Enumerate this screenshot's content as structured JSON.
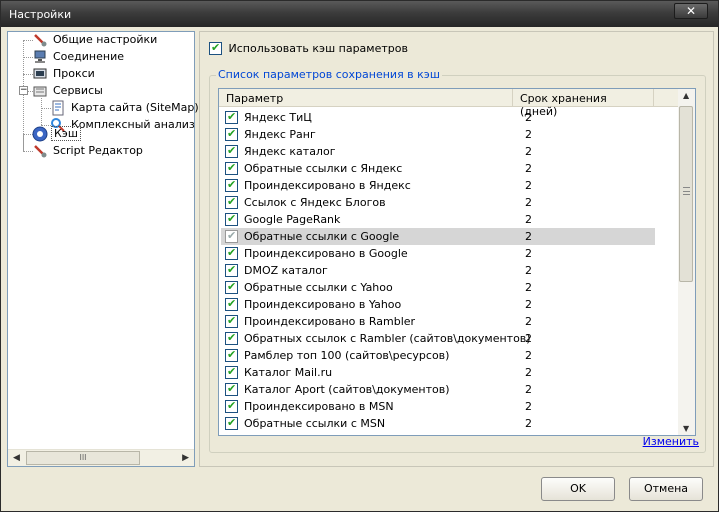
{
  "window": {
    "title": "Настройки",
    "close_label": "✕"
  },
  "tree": {
    "items": [
      {
        "label": "Общие настройки",
        "icon": "wrench-icon"
      },
      {
        "label": "Соединение",
        "icon": "network-icon"
      },
      {
        "label": "Прокси",
        "icon": "proxy-icon"
      },
      {
        "label": "Сервисы",
        "icon": "services-icon",
        "expander": "−"
      },
      {
        "label": "Карта сайта (SiteMap)",
        "icon": "sitemap-icon"
      },
      {
        "label": "Комплексный анализ по",
        "icon": "analysis-icon"
      },
      {
        "label": "Кэш",
        "icon": "cache-icon",
        "selected": true
      },
      {
        "label": "Script Редактор",
        "icon": "wrench-icon"
      }
    ],
    "scroll_grip": "III"
  },
  "settings": {
    "use_cache_label": "Использовать кэш параметров",
    "use_cache_checked": true,
    "group_label": "Список параметров сохранения в кэш",
    "columns": {
      "param": "Параметр",
      "days": "Срок хранения (дней)"
    },
    "rows": [
      {
        "name": "Яндекс ТиЦ",
        "days": "2"
      },
      {
        "name": "Яндекс Ранг",
        "days": "2"
      },
      {
        "name": "Яндекс каталог",
        "days": "2"
      },
      {
        "name": "Обратные ссылки с Яндекс",
        "days": "2"
      },
      {
        "name": "Проиндексировано в Яндекс",
        "days": "2"
      },
      {
        "name": "Ссылок с Яндекс Блогов",
        "days": "2"
      },
      {
        "name": "Google PageRank",
        "days": "2"
      },
      {
        "name": "Обратные ссылки с Google",
        "days": "2",
        "highlighted": true
      },
      {
        "name": "Проиндексировано в Google",
        "days": "2"
      },
      {
        "name": "DMOZ каталог",
        "days": "2"
      },
      {
        "name": "Обратные ссылки с Yahoo",
        "days": "2"
      },
      {
        "name": "Проиндексировано в Yahoo",
        "days": "2"
      },
      {
        "name": "Проиндексировано в Rambler",
        "days": "2"
      },
      {
        "name": "Обратных ссылок с Rambler (сайтов\\документов)",
        "days": "2"
      },
      {
        "name": "Рамблер топ 100 (сайтов\\ресурсов)",
        "days": "2"
      },
      {
        "name": "Каталог Mail.ru",
        "days": "2"
      },
      {
        "name": "Каталог Aport (сайтов\\документов)",
        "days": "2"
      },
      {
        "name": "Проиндексировано в MSN",
        "days": "2"
      },
      {
        "name": "Обратные ссылки с MSN",
        "days": "2"
      }
    ],
    "change_link": "Изменить"
  },
  "buttons": {
    "ok": "OK",
    "cancel": "Отмена"
  },
  "colors": {
    "link": "#0000ee",
    "legend": "#0046d5",
    "check": "#21a121"
  }
}
